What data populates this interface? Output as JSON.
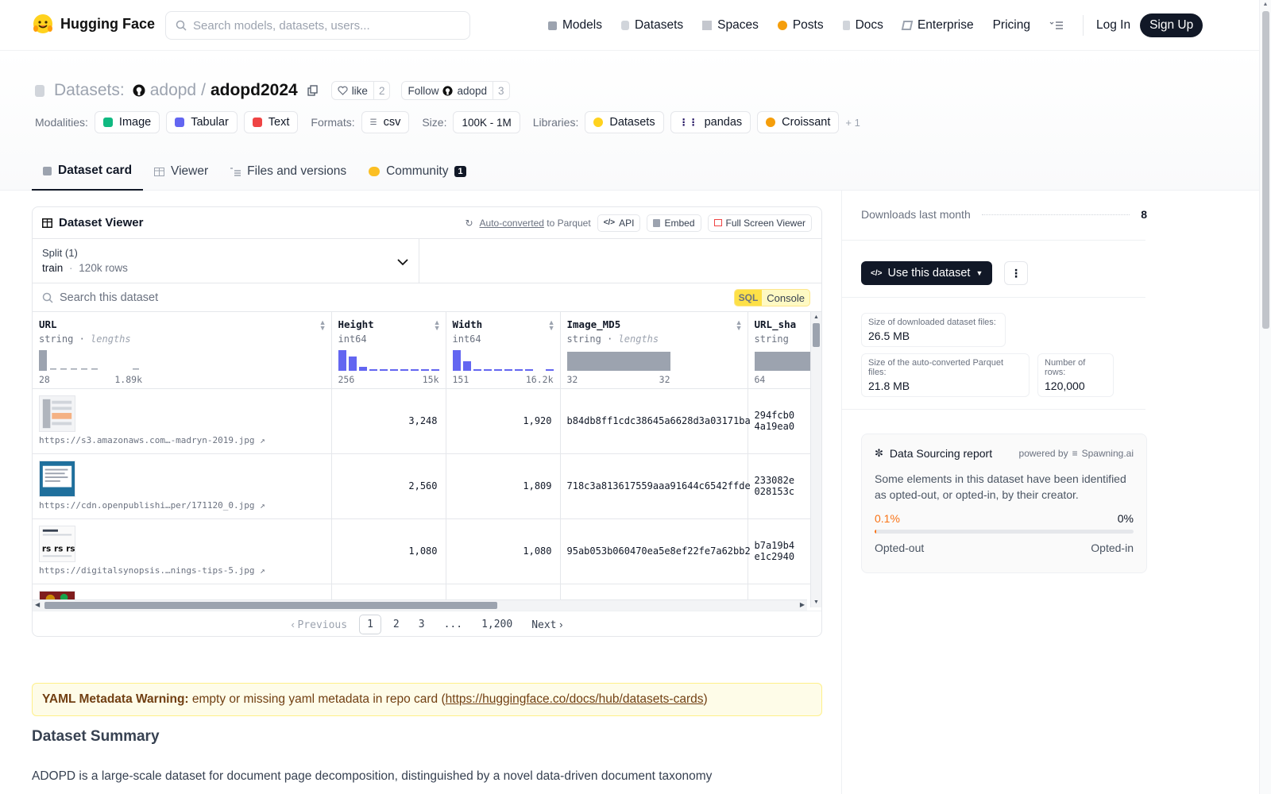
{
  "brand": {
    "name": "Hugging Face"
  },
  "search": {
    "placeholder": "Search models, datasets, users..."
  },
  "nav": {
    "items": [
      "Models",
      "Datasets",
      "Spaces",
      "Posts",
      "Docs",
      "Enterprise",
      "Pricing"
    ],
    "login": "Log In",
    "signup": "Sign Up"
  },
  "repo": {
    "type_label": "Datasets:",
    "owner": "adopd",
    "sep": "/",
    "name": "adopd2024",
    "like_label": "like",
    "like_count": "2",
    "follow_label": "Follow",
    "follow_owner": "adopd",
    "follow_count": "3"
  },
  "meta": {
    "modalities_label": "Modalities:",
    "modalities": [
      "Image",
      "Tabular",
      "Text"
    ],
    "formats_label": "Formats:",
    "formats": [
      "csv"
    ],
    "size_label": "Size:",
    "size": "100K - 1M",
    "libraries_label": "Libraries:",
    "libraries": [
      "Datasets",
      "pandas",
      "Croissant"
    ],
    "more_libs": "+ 1"
  },
  "tabs": [
    {
      "label": "Dataset card",
      "active": true
    },
    {
      "label": "Viewer"
    },
    {
      "label": "Files and versions"
    },
    {
      "label": "Community",
      "badge": "1"
    }
  ],
  "viewer": {
    "title": "Dataset Viewer",
    "auto_converted": "Auto-converted",
    "to_parquet": "to Parquet",
    "api": "API",
    "embed": "Embed",
    "fullscreen": "Full Screen Viewer",
    "split_label": "Split (1)",
    "split_value": "train",
    "split_rows": "120k rows",
    "search_placeholder": "Search this dataset",
    "sql_badge": "SQL",
    "sql_console": "Console",
    "columns": [
      {
        "name": "URL",
        "type": "string",
        "lengths": "lengths",
        "min": "28",
        "max": "1.89k"
      },
      {
        "name": "Height",
        "type": "int64",
        "min": "256",
        "max": "15k"
      },
      {
        "name": "Width",
        "type": "int64",
        "min": "151",
        "max": "16.2k"
      },
      {
        "name": "Image_MD5",
        "type": "string",
        "lengths": "lengths",
        "min": "32",
        "max": "32"
      },
      {
        "name": "URL_sha",
        "type": "string",
        "min": "64"
      }
    ],
    "rows": [
      {
        "url": "https://s3.amazonaws.com…-madryn-2019.jpg",
        "height": "3,248",
        "width": "1,920",
        "md5": "b84db8ff1cdc38645a6628d3a03171ba",
        "sha1": "294fcb0",
        "sha2": "4a19ea0"
      },
      {
        "url": "https://cdn.openpublishi…per/171120_0.jpg",
        "height": "2,560",
        "width": "1,809",
        "md5": "718c3a813617559aaa91644c6542ffde",
        "sha1": "233082e",
        "sha2": "028153c"
      },
      {
        "url": "https://digitalsynopsis.…nings-tips-5.jpg",
        "height": "1,080",
        "width": "1,080",
        "md5": "95ab053b060470ea5e8ef22fe7a62bb2",
        "sha1": "b7a19b4",
        "sha2": "e1c2940"
      }
    ],
    "pager": {
      "prev": "Previous",
      "pages": [
        "1",
        "2",
        "3",
        "...",
        "1,200"
      ],
      "next": "Next"
    }
  },
  "card": {
    "warning_label": "YAML Metadata Warning:",
    "warning_text": " empty or missing yaml metadata in repo card (",
    "warning_link": "https://huggingface.co/docs/hub/datasets-cards",
    "warning_end": ")",
    "summary_title": "Dataset Summary",
    "summary_text": "ADOPD is a large-scale dataset for document page decomposition, distinguished by a novel data-driven document taxonomy"
  },
  "sidebar": {
    "downloads_label": "Downloads last month",
    "downloads_value": "8",
    "use_button": "Use this dataset",
    "stats": [
      {
        "label": "Size of downloaded dataset files:",
        "value": "26.5 MB"
      },
      {
        "label": "Size of the auto-converted Parquet files:",
        "value": "21.8 MB"
      },
      {
        "label": "Number of rows:",
        "value": "120,000"
      }
    ],
    "report": {
      "title": "Data Sourcing report",
      "powered": "powered by",
      "provider": "Spawning.ai",
      "text": "Some elements in this dataset have been identified as opted-out, or opted-in, by their creator.",
      "opted_out_pct": "0.1%",
      "opted_in_pct": "0%",
      "opted_out_fraction": 0.001,
      "opted_out_label": "Opted-out",
      "opted_in_label": "Opted-in"
    }
  },
  "colors": {
    "accent": "#f97316",
    "dark": "#111827",
    "hist_blue": "#6366f1",
    "hist_gray": "#9ca3af"
  }
}
